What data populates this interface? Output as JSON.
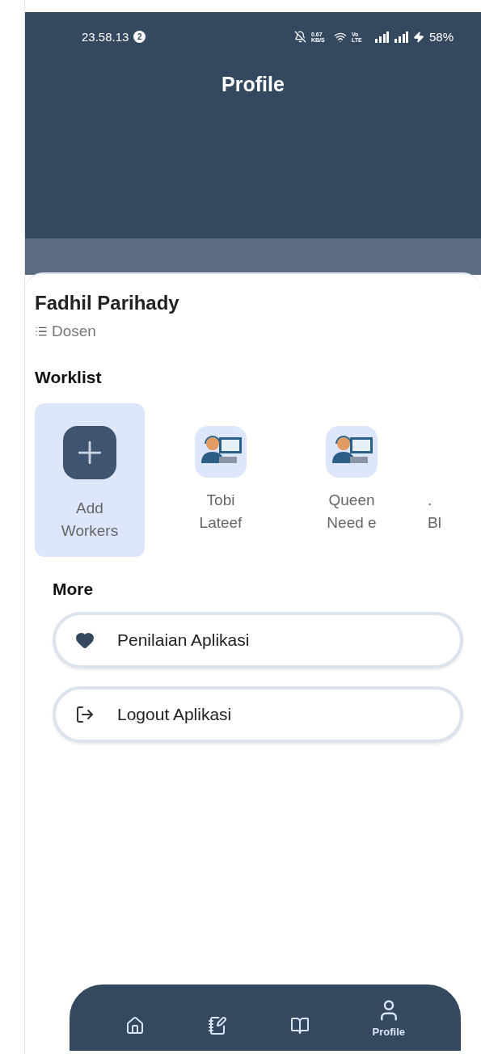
{
  "status_bar": {
    "time": "23.58.13",
    "notification_count": "2",
    "speed": "0.67 KB/S",
    "network": "Vo LTE",
    "battery": "58%"
  },
  "header": {
    "title": "Profile"
  },
  "profile": {
    "name": "Fadhil Parihady",
    "role": "Dosen"
  },
  "worklist": {
    "title": "Worklist",
    "items": [
      {
        "kind": "add",
        "lines": [
          "Add",
          "Workers"
        ],
        "selected": true
      },
      {
        "kind": "worker",
        "lines": [
          "Tobi",
          "Lateef"
        ],
        "selected": false
      },
      {
        "kind": "worker",
        "lines": [
          "Queen",
          "Need e"
        ],
        "selected": false
      },
      {
        "kind": "peek",
        "lines": [
          ".",
          "Bl"
        ],
        "selected": false
      }
    ]
  },
  "more": {
    "title": "More",
    "items": [
      {
        "kind": "rate",
        "label": "Penilaian Aplikasi"
      },
      {
        "kind": "logout",
        "label": "Logout Aplikasi"
      }
    ]
  },
  "bottom_nav": [
    {
      "kind": "home",
      "selected": false
    },
    {
      "kind": "notes",
      "selected": false
    },
    {
      "kind": "book",
      "selected": false
    },
    {
      "kind": "user",
      "label": "Profile",
      "selected": true
    }
  ]
}
